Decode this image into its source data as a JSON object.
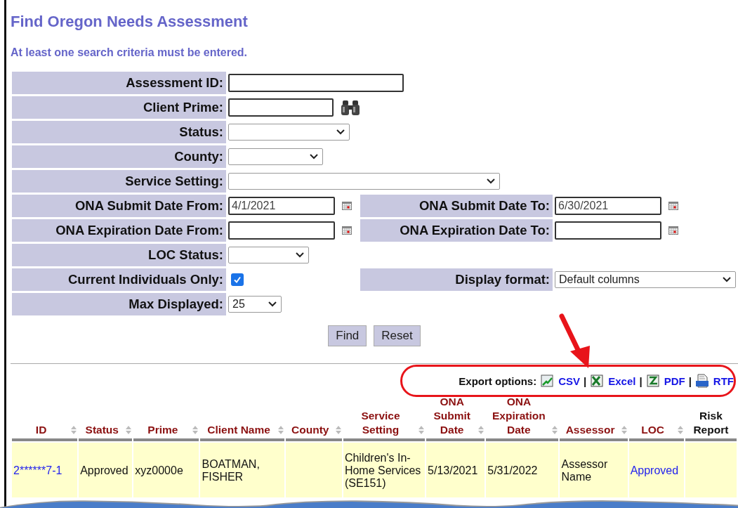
{
  "title": "Find Oregon Needs Assessment",
  "note": "At least one search criteria must be entered.",
  "form": {
    "rows": [
      {
        "left": {
          "kind": "text",
          "label": "Assessment ID:"
        }
      },
      {
        "left": {
          "kind": "lookup",
          "label": "Client Prime:"
        }
      },
      {
        "left": {
          "kind": "select",
          "label": "Status:"
        }
      },
      {
        "left": {
          "kind": "select",
          "label": "County:"
        }
      },
      {
        "left": {
          "kind": "select",
          "label": "Service Setting:"
        }
      },
      {
        "left": {
          "kind": "date",
          "label": "ONA Submit Date From:",
          "value": "4/1/2021"
        },
        "right": {
          "kind": "date",
          "label": "ONA Submit Date To:",
          "value": "6/30/2021"
        }
      },
      {
        "left": {
          "kind": "date",
          "label": "ONA Expiration Date From:"
        },
        "right": {
          "kind": "date",
          "label": "ONA Expiration Date To:"
        }
      },
      {
        "left": {
          "kind": "select",
          "label": "LOC Status:"
        }
      },
      {
        "left": {
          "kind": "checkbox",
          "label": "Current Individuals Only:",
          "checked": true
        },
        "right": {
          "kind": "select",
          "label": "Display format:",
          "value": "Default columns"
        }
      },
      {
        "left": {
          "kind": "select",
          "label": "Max Displayed:",
          "value": "25"
        }
      }
    ],
    "buttons": [
      "Find",
      "Reset"
    ]
  },
  "export": {
    "label": "Export options:",
    "separator": "|",
    "links": [
      {
        "kind": "csv",
        "text": "CSV"
      },
      {
        "kind": "excel",
        "text": "Excel"
      },
      {
        "kind": "pdf",
        "text": "PDF"
      },
      {
        "kind": "rtf",
        "text": "RTF"
      }
    ]
  },
  "table": {
    "columns": [
      {
        "label": "ID",
        "sortable": true
      },
      {
        "label": "Status",
        "sortable": true
      },
      {
        "label": "Prime",
        "sortable": true
      },
      {
        "label": "Client Name",
        "sortable": true
      },
      {
        "label": "County",
        "sortable": true
      },
      {
        "label": "Service Setting",
        "sortable": true
      },
      {
        "label": "ONA Submit Date",
        "sortable": true
      },
      {
        "label": "ONA Expiration Date",
        "sortable": true
      },
      {
        "label": "Assessor",
        "sortable": true
      },
      {
        "label": "LOC",
        "sortable": true
      },
      {
        "label": "Risk Report",
        "sortable": false
      }
    ],
    "rows": [
      {
        "cells": [
          {
            "text": "2******7-1",
            "link": true
          },
          {
            "text": "Approved",
            "link": false
          },
          {
            "text": "xyz0000e",
            "link": false
          },
          {
            "text": "BOATMAN, FISHER",
            "link": false
          },
          {},
          {
            "text": "Children's In-Home Services (SE151)",
            "link": false
          },
          {
            "text": "5/13/2021",
            "link": false
          },
          {
            "text": "5/31/2022",
            "link": false
          },
          {
            "text": "Assessor Name",
            "link": false
          },
          {
            "text": "Approved",
            "link": true
          },
          {}
        ]
      }
    ]
  }
}
